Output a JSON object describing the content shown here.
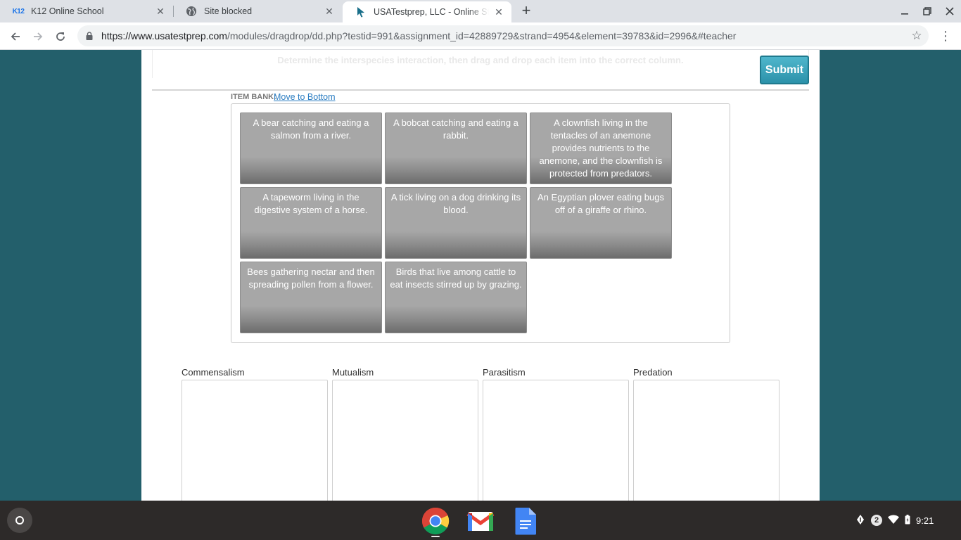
{
  "browser": {
    "tabs": [
      {
        "title": "K12 Online School",
        "favicon": "k12-logo",
        "logo_text": "K12"
      },
      {
        "title": "Site blocked",
        "favicon": "globe-icon"
      },
      {
        "title": "USATestprep, LLC - Online State-Specific",
        "favicon": "cursor-icon",
        "active": true
      }
    ],
    "url_host": "https://www.usatestprep.com",
    "url_path": "/modules/dragdrop/dd.php?testid=991&assignment_id=42889729&strand=4954&element=39783&id=2996&#teacher"
  },
  "page": {
    "instructions": "Determine the interspecies interaction, then drag and drop each item into the correct column.",
    "submit_label": "Submit",
    "item_bank_label": "ITEM BANK:",
    "item_bank_link": "Move to Bottom",
    "items": [
      "A bear catching and eating a salmon from a river.",
      "A bobcat catching and eating a rabbit.",
      "A clownfish living in the tentacles of an anemone provides nutrients to the anemone, and the clownfish is protected from predators.",
      "A tapeworm living in the digestive system of a horse.",
      "A tick living on a dog drinking its blood.",
      "An Egyptian plover eating bugs off of a giraffe or rhino.",
      "Bees gathering nectar and then spreading pollen from a flower.",
      "Birds that live among cattle to eat insects stirred up by grazing."
    ],
    "columns": [
      "Commensalism",
      "Mutualism",
      "Parasitism",
      "Predation"
    ]
  },
  "shelf": {
    "apps": [
      "chrome-icon",
      "gmail-icon",
      "docs-icon"
    ],
    "notification_count": "2",
    "time": "9:21"
  },
  "colors": {
    "page_background": "#235f6b",
    "submit_button": "#3aa3bb",
    "card": "#a7a7a7",
    "link": "#2b7dc2"
  }
}
